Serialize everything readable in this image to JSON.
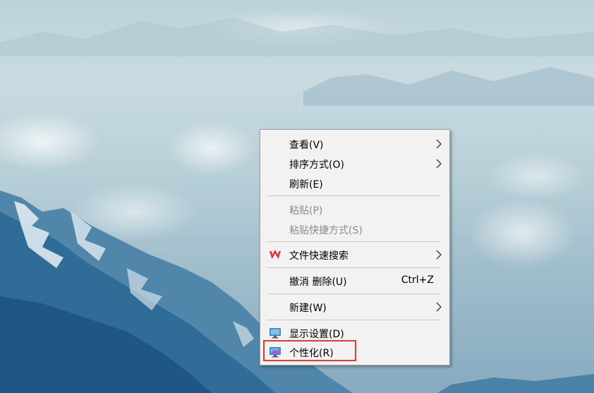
{
  "menu": {
    "items": [
      {
        "label": "查看(V)"
      },
      {
        "label": "排序方式(O)"
      },
      {
        "label": "刷新(E)"
      },
      {
        "label": "粘贴(P)"
      },
      {
        "label": "粘贴快捷方式(S)"
      },
      {
        "label": "文件快速搜索",
        "icon": "wps-icon"
      },
      {
        "label": "撤消 删除(U)",
        "shortcut": "Ctrl+Z"
      },
      {
        "label": "新建(W)"
      },
      {
        "label": "显示设置(D)",
        "icon": "display-settings-icon"
      },
      {
        "label": "个性化(R)",
        "icon": "personalize-icon"
      }
    ]
  },
  "colors": {
    "menu_bg": "#f2f2f2",
    "disabled_text": "#8a8a8a",
    "highlight": "#e53935",
    "wps_red": "#e8312f"
  }
}
